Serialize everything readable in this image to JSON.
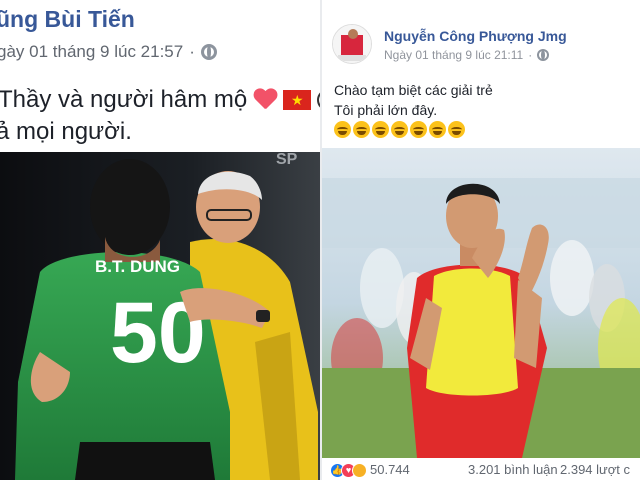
{
  "left_post": {
    "author": "ũng Bùi Tiến",
    "timestamp": "gày 01 tháng 9 lúc 21:57",
    "privacy_icon": "globe-icon",
    "text_line1": "Thầy và người hâm mộ",
    "text_line2": "ả mọi người.",
    "emojis": [
      "heart",
      "vietnam-flag",
      "soccer-ball"
    ],
    "photo": {
      "jersey_name": "B.T. DUNG",
      "jersey_number": "50",
      "watermark": "SP",
      "jersey_color": "#2e9a48"
    }
  },
  "right_post": {
    "author": "Nguyễn Công Phượng Jmg",
    "timestamp": "Ngày 01 tháng 9 lúc 21:11",
    "privacy_icon": "globe-icon",
    "text_line1": "Chào tạm biệt các giải trẻ",
    "text_line2": "Tôi phải lớn đây.",
    "emoji_count": 7,
    "reactions": {
      "count": "50.744",
      "comments": "3.201 bình luận",
      "shares": "2.394 lượt c"
    }
  }
}
